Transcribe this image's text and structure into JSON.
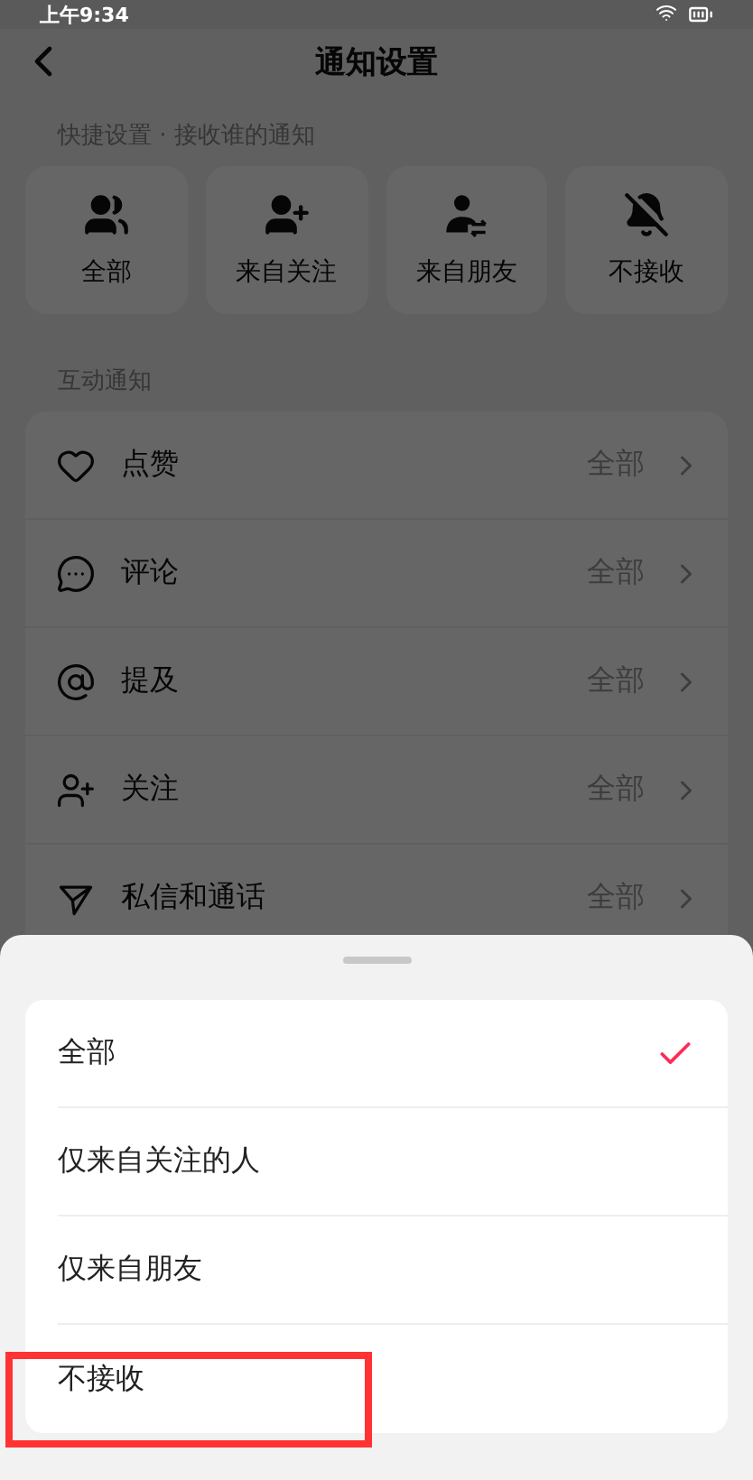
{
  "status_bar": {
    "time": "上午9:34"
  },
  "header": {
    "title": "通知设置"
  },
  "quick_settings": {
    "label": "快捷设置 · 接收谁的通知",
    "options": [
      {
        "kind": "all",
        "label": "全部"
      },
      {
        "kind": "following",
        "label": "来自关注"
      },
      {
        "kind": "friends",
        "label": "来自朋友"
      },
      {
        "kind": "none",
        "label": "不接收"
      }
    ]
  },
  "interaction": {
    "label": "互动通知",
    "rows": [
      {
        "kind": "like",
        "label": "点赞",
        "value": "全部"
      },
      {
        "kind": "comment",
        "label": "评论",
        "value": "全部"
      },
      {
        "kind": "mention",
        "label": "提及",
        "value": "全部"
      },
      {
        "kind": "follow",
        "label": "关注",
        "value": "全部"
      },
      {
        "kind": "message",
        "label": "私信和通话",
        "value": "全部"
      }
    ]
  },
  "sheet": {
    "options": [
      {
        "label": "全部",
        "selected": true,
        "highlighted": false
      },
      {
        "label": "仅来自关注的人",
        "selected": false,
        "highlighted": false
      },
      {
        "label": "仅来自朋友",
        "selected": false,
        "highlighted": false
      },
      {
        "label": "不接收",
        "selected": false,
        "highlighted": true
      }
    ]
  }
}
